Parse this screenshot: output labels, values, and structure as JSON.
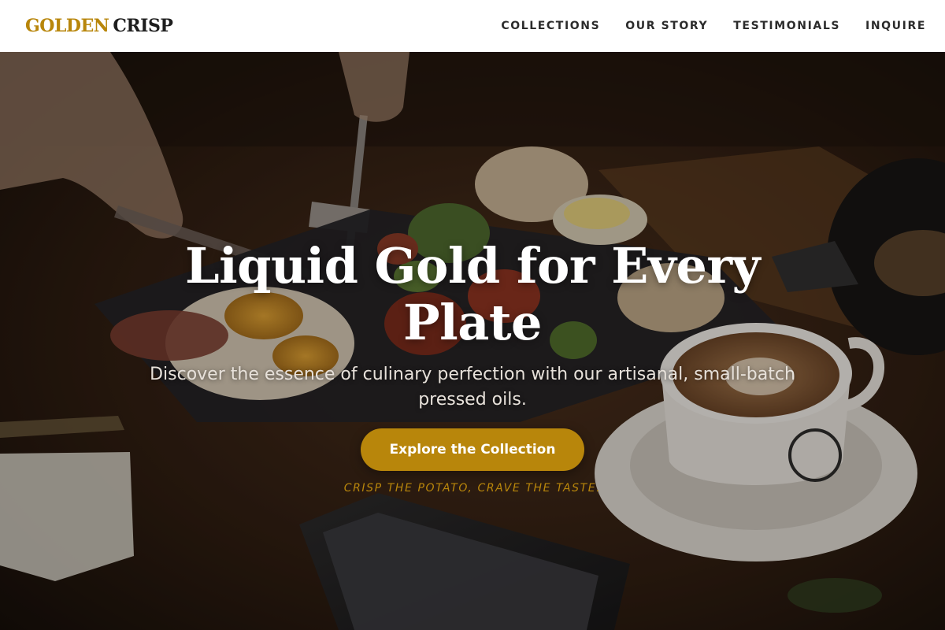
{
  "header": {
    "logo_word1": "GOLDEN",
    "logo_word2": "CRISP",
    "nav": [
      {
        "label": "COLLECTIONS"
      },
      {
        "label": "OUR STORY"
      },
      {
        "label": "TESTIMONIALS"
      },
      {
        "label": "INQUIRE"
      }
    ]
  },
  "hero": {
    "title": "Liquid Gold for Every Plate",
    "subtitle": "Discover the essence of culinary perfection with our artisanal, small-batch pressed oils.",
    "cta_label": "Explore the Collection",
    "tagline": "CRISP THE POTATO, CRAVE THE TASTE."
  },
  "colors": {
    "accent": "#b8860b",
    "header_bg": "#ffffff",
    "nav_text": "#2b2b2b",
    "hero_text": "#ffffff"
  }
}
